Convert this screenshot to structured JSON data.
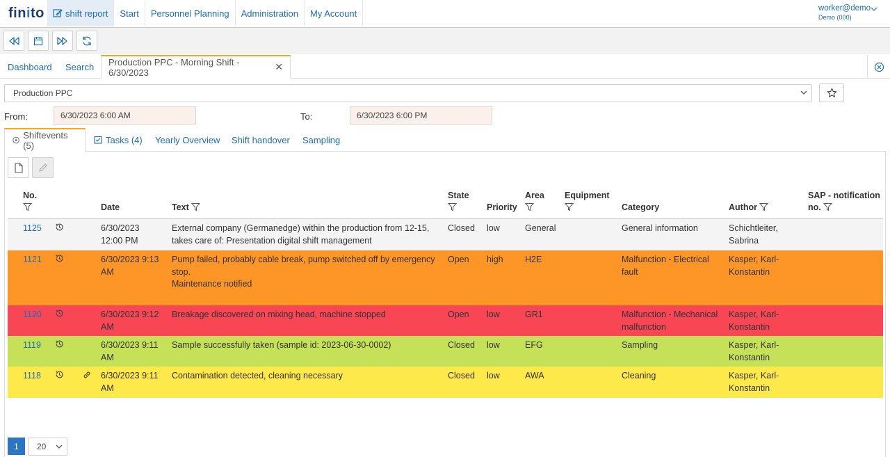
{
  "app": {
    "logo": "finito",
    "nav": [
      "shift report",
      "Start",
      "Personnel Planning",
      "Administration",
      "My Account"
    ],
    "user": {
      "name": "worker@demo",
      "tenant": "Demo (000)"
    }
  },
  "tabs": {
    "dashboard": "Dashboard",
    "search": "Search",
    "active": "Production PPC - Morning Shift - 6/30/2023"
  },
  "filter": {
    "area_select": "Production PPC",
    "from_label": "From:",
    "from_value": "6/30/2023 6:00 AM",
    "to_label": "To:",
    "to_value": "6/30/2023 6:00 PM"
  },
  "subtabs": [
    "Shiftevents (5)",
    "Tasks (4)",
    "Yearly Overview",
    "Shift handover",
    "Sampling"
  ],
  "table": {
    "headers": {
      "no": "No.",
      "date": "Date",
      "text": "Text",
      "state": "State",
      "priority": "Priority",
      "area": "Area",
      "equipment": "Equipment",
      "category": "Category",
      "author": "Author",
      "sap1": "SAP - notification",
      "sap2": "no."
    },
    "rows": [
      {
        "no": "1125",
        "date": [
          "6/30/2023",
          "12:00 PM"
        ],
        "text": [
          "External company (Germanedge) within the production from 12-15,",
          "takes care of: Presentation digital shift management"
        ],
        "state": "Closed",
        "priority": "low",
        "area": "General",
        "equipment": "",
        "category": [
          "General information"
        ],
        "author": [
          "Schichtleiter,",
          "Sabrina"
        ],
        "sap": "",
        "color": "#f4f4f4",
        "link": false
      },
      {
        "no": "1121",
        "date": [
          "6/30/2023 9:13",
          "AM"
        ],
        "text": [
          "Pump failed, probably cable break, pump switched off by emergency",
          "stop.",
          "Maintenance notified"
        ],
        "state": "Open",
        "priority": "high",
        "area": "H2E",
        "equipment": "",
        "category": [
          "Malfunction - Electrical",
          "fault"
        ],
        "author": [
          "Kasper, Karl-",
          "Konstantin"
        ],
        "sap": "",
        "color": "#fe9627",
        "link": false
      },
      {
        "no": "1120",
        "date": [
          "6/30/2023 9:12",
          "AM"
        ],
        "text": [
          "Breakage discovered on mixing head, machine stopped"
        ],
        "state": "Open",
        "priority": "low",
        "area": "GR1",
        "equipment": "",
        "category": [
          "Malfunction - Mechanical",
          "malfunction"
        ],
        "author": [
          "Kasper, Karl-",
          "Konstantin"
        ],
        "sap": "",
        "color": "#f84655",
        "link": false
      },
      {
        "no": "1119",
        "date": [
          "6/30/2023 9:11",
          "AM"
        ],
        "text": [
          "Sample successfully taken (sample id: 2023-06-30-0002)"
        ],
        "state": "Closed",
        "priority": "low",
        "area": "EFG",
        "equipment": "",
        "category": [
          "Sampling"
        ],
        "author": [
          "Kasper, Karl-",
          "Konstantin"
        ],
        "sap": "",
        "color": "#c4e158",
        "link": false
      },
      {
        "no": "1118",
        "date": [
          "6/30/2023 9:11",
          "AM"
        ],
        "text": [
          "Contamination detected, cleaning necessary"
        ],
        "state": "Closed",
        "priority": "low",
        "area": "AWA",
        "equipment": "",
        "category": [
          "Cleaning"
        ],
        "author": [
          "Kasper, Karl-",
          "Konstantin"
        ],
        "sap": "",
        "color": "#fee94b",
        "link": true
      }
    ]
  },
  "pagination": {
    "page": "1",
    "page_size": "20"
  }
}
